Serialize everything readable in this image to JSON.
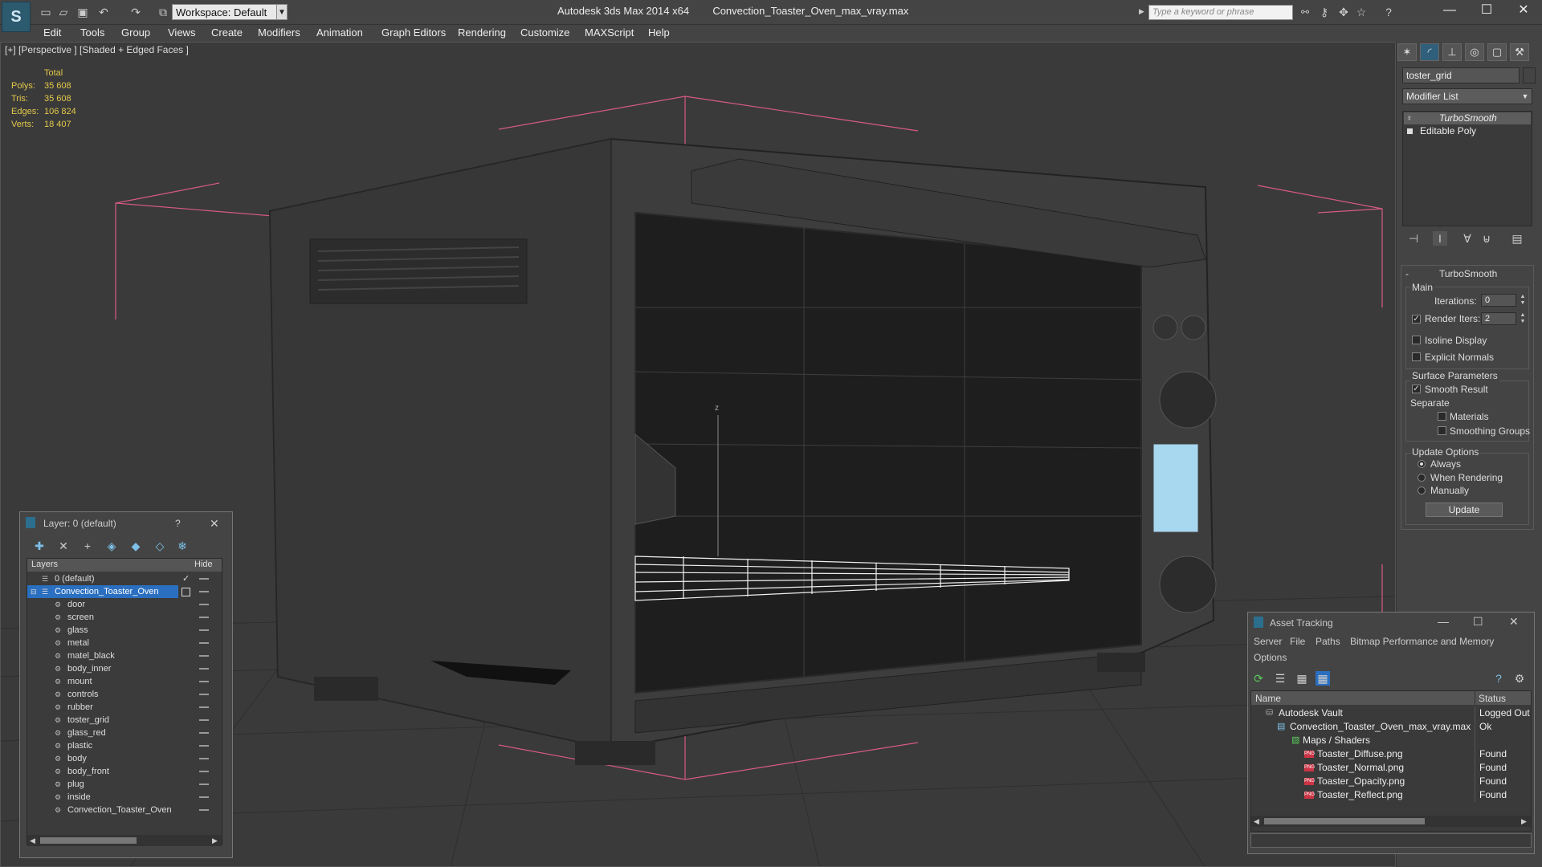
{
  "app": {
    "logo_letter": "S",
    "title": "Autodesk 3ds Max  2014 x64",
    "file_title": "Convection_Toaster_Oven_max_vray.max",
    "workspace": "Workspace: Default",
    "search_placeholder": "Type a keyword or phrase",
    "window_min": "—",
    "window_max": "☐",
    "window_close": "✕"
  },
  "menu": [
    "Edit",
    "Tools",
    "Group",
    "Views",
    "Create",
    "Modifiers",
    "Animation",
    "Graph Editors",
    "Rendering",
    "Customize",
    "MAXScript",
    "Help"
  ],
  "viewport": {
    "label": "[+] [Perspective ] [Shaded + Edged Faces ]",
    "stats_header": "Total",
    "stats": [
      {
        "label": "Polys:",
        "value": "35 608"
      },
      {
        "label": "Tris:",
        "value": "35 608"
      },
      {
        "label": "Edges:",
        "value": "106 824"
      },
      {
        "label": "Verts:",
        "value": "18 407"
      }
    ],
    "axis_label": "z"
  },
  "command_panel": {
    "object_name": "toster_grid",
    "modifier_list": "Modifier List",
    "stack": [
      "TurboSmooth",
      "Editable Poly"
    ],
    "rollout_title": "TurboSmooth",
    "main_group": "Main",
    "iterations_label": "Iterations:",
    "iterations_value": "0",
    "render_iters_label": "Render Iters:",
    "render_iters_value": "2",
    "render_iters_checked": true,
    "isoline_label": "Isoline Display",
    "explicit_normals_label": "Explicit Normals",
    "surface_group": "Surface Parameters",
    "smooth_result_label": "Smooth Result",
    "smooth_result_checked": true,
    "separate_label": "Separate",
    "materials_label": "Materials",
    "smoothing_groups_label": "Smoothing Groups",
    "update_group": "Update Options",
    "update_options": [
      {
        "label": "Always",
        "selected": true
      },
      {
        "label": "When Rendering",
        "selected": false
      },
      {
        "label": "Manually",
        "selected": false
      }
    ],
    "update_button": "Update"
  },
  "layer_dialog": {
    "title": "Layer: 0 (default)",
    "help": "?",
    "close": "✕",
    "col_layers": "Layers",
    "col_hide": "Hide",
    "layers": [
      {
        "name": "0 (default)",
        "level": 0,
        "selected": false,
        "check": "✓"
      },
      {
        "name": "Convection_Toaster_Oven",
        "level": 0,
        "selected": true,
        "check": ""
      },
      {
        "name": "door",
        "level": 1
      },
      {
        "name": "screen",
        "level": 1
      },
      {
        "name": "glass",
        "level": 1
      },
      {
        "name": "metal",
        "level": 1
      },
      {
        "name": "matel_black",
        "level": 1
      },
      {
        "name": "body_inner",
        "level": 1
      },
      {
        "name": "mount",
        "level": 1
      },
      {
        "name": "controls",
        "level": 1
      },
      {
        "name": "rubber",
        "level": 1
      },
      {
        "name": "toster_grid",
        "level": 1
      },
      {
        "name": "glass_red",
        "level": 1
      },
      {
        "name": "plastic",
        "level": 1
      },
      {
        "name": "body",
        "level": 1
      },
      {
        "name": "body_front",
        "level": 1
      },
      {
        "name": "plug",
        "level": 1
      },
      {
        "name": "inside",
        "level": 1
      },
      {
        "name": "Convection_Toaster_Oven",
        "level": 1
      }
    ]
  },
  "asset_dialog": {
    "title": "Asset Tracking",
    "menu": [
      "Server",
      "File",
      "Paths",
      "Bitmap Performance and Memory",
      "Options"
    ],
    "col_name": "Name",
    "col_status": "Status",
    "rows": [
      {
        "name": "Autodesk Vault",
        "status": "Logged Out",
        "indent": 0,
        "icon": "vault-icon"
      },
      {
        "name": "Convection_Toaster_Oven_max_vray.max",
        "status": "Ok",
        "indent": 1,
        "icon": "max-file-icon"
      },
      {
        "name": "Maps / Shaders",
        "status": "",
        "indent": 2,
        "icon": "maps-icon"
      },
      {
        "name": "Toaster_Diffuse.png",
        "status": "Found",
        "indent": 3,
        "icon": "png-icon"
      },
      {
        "name": "Toaster_Normal.png",
        "status": "Found",
        "indent": 3,
        "icon": "png-icon"
      },
      {
        "name": "Toaster_Opacity.png",
        "status": "Found",
        "indent": 3,
        "icon": "png-icon"
      },
      {
        "name": "Toaster_Reflect.png",
        "status": "Found",
        "indent": 3,
        "icon": "png-icon"
      }
    ]
  }
}
